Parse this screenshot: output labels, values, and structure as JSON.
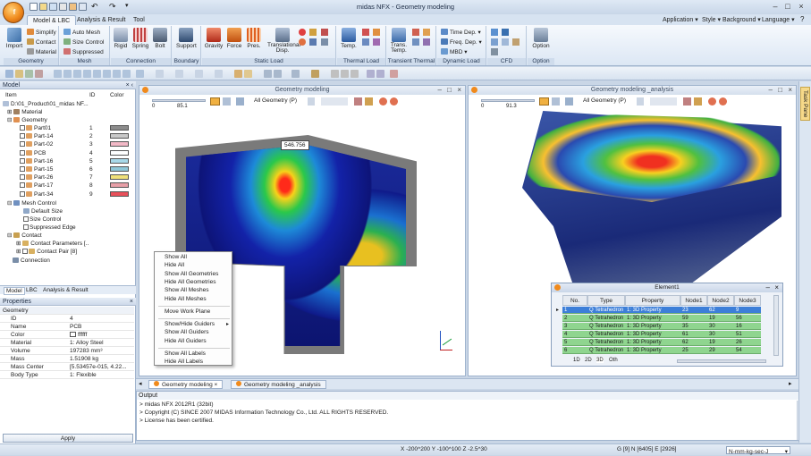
{
  "window": {
    "title": "midas NFX - Geometry modeling",
    "app_logo": "f"
  },
  "ribbon_tabs": [
    {
      "label": "Model & LBC",
      "active": true
    },
    {
      "label": "Analysis & Result",
      "active": false
    },
    {
      "label": "Tool",
      "active": false
    }
  ],
  "right_menus": [
    "Application",
    "Style",
    "Background",
    "Language"
  ],
  "ribbon": {
    "geometry": {
      "label": "Geometry",
      "import": "Import",
      "simplify": "Simplify",
      "contact": "Contact",
      "material": "Material"
    },
    "mesh": {
      "label": "Mesh",
      "auto_mesh": "Auto Mesh",
      "size_control": "Size Control",
      "suppressed": "Suppressed"
    },
    "connection": {
      "label": "Connection",
      "rigid": "Rigid",
      "spring": "Spring",
      "bolt": "Bolt"
    },
    "boundary": {
      "label": "Boundary",
      "support": "Support"
    },
    "static_load": {
      "label": "Static Load",
      "gravity": "Gravity",
      "force": "Force",
      "pres": "Pres.",
      "translational": "Translational\nDisp."
    },
    "thermal_load": {
      "label": "Thermal Load",
      "temp": "Temp."
    },
    "transient_thermal": {
      "label": "Transient Thermal",
      "trans_temp": "Trans.\nTemp."
    },
    "dynamic_load": {
      "label": "Dynamic Load",
      "time_dep": "Time Dep.",
      "freq_dep": "Freq. Dep.",
      "mbd": "MBD"
    },
    "cfd": {
      "label": "CFD"
    },
    "option": {
      "label": "Option",
      "option": "Option"
    }
  },
  "model_panel": {
    "title": "Model",
    "columns": {
      "item": "Item",
      "id": "ID",
      "color": "Color"
    },
    "root": "D:\\01_Product\\01_midas NF...",
    "material": "Material",
    "geometry": "Geometry",
    "parts": [
      {
        "name": "Part01",
        "id": "1",
        "color": "#8c8c8c"
      },
      {
        "name": "Part-14",
        "id": "2",
        "color": "#c9c9c9"
      },
      {
        "name": "Part-02",
        "id": "3",
        "color": "#f2b8c6"
      },
      {
        "name": "PCB",
        "id": "4",
        "color": "#ffffff"
      },
      {
        "name": "Part-16",
        "id": "5",
        "color": "#a8d8e8"
      },
      {
        "name": "Part-15",
        "id": "6",
        "color": "#8fc7d8"
      },
      {
        "name": "Part-26",
        "id": "7",
        "color": "#f0e07a"
      },
      {
        "name": "Part-17",
        "id": "8",
        "color": "#e8a0a8"
      },
      {
        "name": "Part-34",
        "id": "9",
        "color": "#e8505a"
      }
    ],
    "mesh_control": "Mesh Control",
    "default_size": "Default Size",
    "size_control": "Size Control",
    "suppressed_edge": "Suppressed Edge",
    "contact": "Contact",
    "contact_parameters": "Contact Parameters [..",
    "contact_pair": "Contact Pair [8]",
    "connection": "Connection",
    "tabs": [
      "Model",
      "LBC",
      "Analysis & Result"
    ]
  },
  "properties": {
    "title": "Properties",
    "section": "Geometry",
    "rows": [
      {
        "k": "ID",
        "v": "4"
      },
      {
        "k": "Name",
        "v": "PCB"
      },
      {
        "k": "Color",
        "v": "ffffff"
      },
      {
        "k": "Material",
        "v": "1: Alloy Steel"
      },
      {
        "k": "Volume",
        "v": "197283 mm³"
      },
      {
        "k": "Mass",
        "v": "1.51908 kg"
      },
      {
        "k": "Mass Center",
        "v": "[5.53457e-015, 4.22..."
      },
      {
        "k": "Body Type",
        "v": "1: Flexible"
      }
    ],
    "apply": "Apply"
  },
  "viewport1": {
    "title": "Geometry modeling",
    "scale_min": "0",
    "scale_max": "85.1",
    "filter": "All Geometry (P)",
    "probe_label": "546.756"
  },
  "viewport2": {
    "title": "Geometry modeling _analysis",
    "scale_min": "0",
    "scale_max": "91.3",
    "filter": "All Geometry (P)"
  },
  "context_menu": [
    [
      "Show All",
      "Hide All",
      "Show All Geometries",
      "Hide All Geometries",
      "Show All Meshes",
      "Hide All Meshes"
    ],
    [
      "Move Work Plane"
    ],
    [
      "Show/Hide Guiders",
      "Show All Guiders",
      "Hide All Guiders"
    ],
    [
      "Show All Labels",
      "Hide All Labels"
    ]
  ],
  "element_window": {
    "title": "Element1",
    "headers": [
      "No.",
      "Type",
      "Property",
      "Node1",
      "Node2",
      "Node3"
    ],
    "rows": [
      [
        "1",
        "Q Tetrahedron",
        "1: 3D Property",
        "23",
        "62",
        "9"
      ],
      [
        "2",
        "Q Tetrahedron",
        "1: 3D Property",
        "59",
        "19",
        "56"
      ],
      [
        "3",
        "Q Tetrahedron",
        "1: 3D Property",
        "35",
        "30",
        "16"
      ],
      [
        "4",
        "Q Tetrahedron",
        "1: 3D Property",
        "61",
        "30",
        "51"
      ],
      [
        "5",
        "Q Tetrahedron",
        "1: 3D Property",
        "62",
        "19",
        "26"
      ],
      [
        "6",
        "Q Tetrahedron",
        "1: 3D Property",
        "25",
        "29",
        "54"
      ]
    ],
    "sheet_tabs": [
      "1D",
      "2D",
      "3D",
      "Oth"
    ]
  },
  "doc_tabs": [
    "Geometry modeling",
    "Geometry modeling _analysis"
  ],
  "output": {
    "title": "Output",
    "lines": [
      "> midas NFX 2012R1 (32bit)",
      "> Copyright (C) SINCE 2007 MIDAS Information Technology Co., Ltd. ALL RIGHTS RESERVED.",
      "> License has been certified."
    ]
  },
  "status": {
    "coords": "X -200^200 Y -100^100 Z -2.5^30",
    "counts": "G [9] N [6405] E [2926]",
    "units": "N-mm-kg-sec-J"
  },
  "task_pane": "Task Pane"
}
